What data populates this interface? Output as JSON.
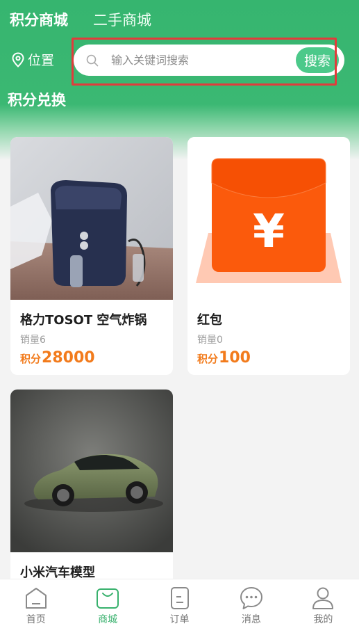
{
  "header": {
    "tabs": [
      {
        "label": "积分商城",
        "active": true
      },
      {
        "label": "二手商城",
        "active": false
      }
    ],
    "location_label": "位置",
    "search": {
      "placeholder": "输入关键词搜索",
      "value": "",
      "button_label": "搜索"
    },
    "section_title": "积分兑换"
  },
  "products": [
    {
      "name": "格力TOSOT 空气炸锅",
      "sales": "销量6",
      "price_unit": "积分",
      "price": "28000",
      "image": "air-fryer"
    },
    {
      "name": "红包",
      "sales": "销量0",
      "price_unit": "积分",
      "price": "100",
      "image": "red-packet"
    },
    {
      "name": "小米汽车模型",
      "sales": "",
      "price_unit": "",
      "price": "",
      "image": "car-model"
    }
  ],
  "bottom_nav": [
    {
      "label": "首页",
      "icon": "home-icon",
      "active": false
    },
    {
      "label": "商城",
      "icon": "shop-bag-icon",
      "active": true
    },
    {
      "label": "订单",
      "icon": "order-icon",
      "active": false
    },
    {
      "label": "消息",
      "icon": "message-icon",
      "active": false
    },
    {
      "label": "我的",
      "icon": "profile-icon",
      "active": false
    }
  ],
  "colors": {
    "brand_green": "#36b56f",
    "price_orange": "#f27b1c",
    "highlight_red": "#e23b3b"
  }
}
